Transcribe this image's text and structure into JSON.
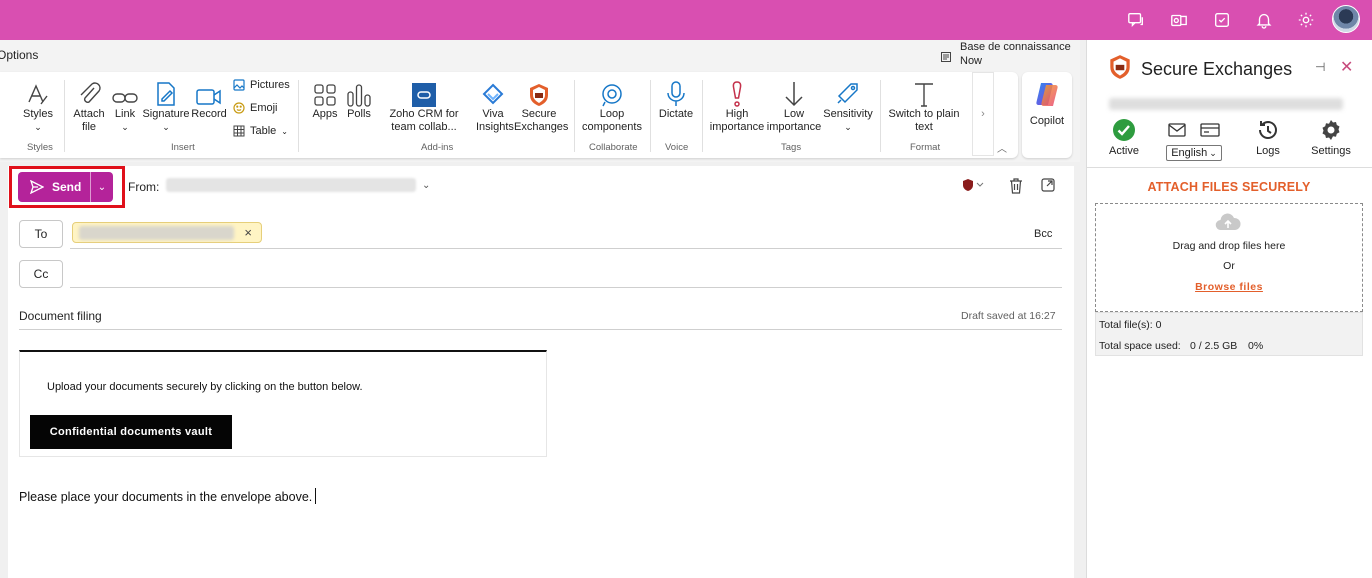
{
  "colors": {
    "topbar": "#d94fb1",
    "send": "#b4239a",
    "accent_orange": "#e35f2b",
    "highlight_box": "#e0101a"
  },
  "topbar": {
    "icons": [
      "chat-feedback-icon",
      "outlook-icon",
      "checklist-icon",
      "bell-icon",
      "settings-icon"
    ]
  },
  "header": {
    "options_label": "Options"
  },
  "knowledge_base": {
    "title": "Base de connaissance",
    "subtitle": "Now"
  },
  "ribbon": {
    "styles": {
      "label": "Styles",
      "group": "Styles"
    },
    "insert": {
      "attach": "Attach file",
      "link": "Link",
      "signature": "Signature",
      "record": "Record",
      "pictures": "Pictures",
      "emoji": "Emoji",
      "table": "Table",
      "group": "Insert"
    },
    "addins": {
      "apps": "Apps",
      "polls": "Polls",
      "zoho": "Zoho CRM for team collab...",
      "viva": "Viva Insights",
      "secure": "Secure Exchanges",
      "group": "Add-ins"
    },
    "collaborate": {
      "loop": "Loop components",
      "group": "Collaborate"
    },
    "voice": {
      "dictate": "Dictate",
      "group": "Voice"
    },
    "tags": {
      "high": "High importance",
      "low": "Low importance",
      "sensitivity": "Sensitivity",
      "group": "Tags"
    },
    "format": {
      "plain": "Switch to plain text",
      "group": "Format"
    },
    "copilot": "Copilot"
  },
  "compose": {
    "send_label": "Send",
    "from_label": "From:",
    "to_label": "To",
    "cc_label": "Cc",
    "bcc_label": "Bcc",
    "subject": "Document filing",
    "draft_status": "Draft saved at 16:27",
    "card_text": "Upload your documents securely by clicking on the button below.",
    "vault_button": "Confidential documents vault",
    "body_text": "Please place your documents in the envelope above."
  },
  "panel": {
    "title": "Secure Exchanges",
    "tools": {
      "active": "Active",
      "language": "English",
      "logs": "Logs",
      "settings": "Settings"
    },
    "attach_title": "ATTACH FILES SECURELY",
    "drop_text": "Drag and drop files here",
    "or_text": "Or",
    "browse": "Browse files",
    "total_files": "Total file(s): 0",
    "total_space_label": "Total space used:",
    "total_space_value": "0 / 2.5 GB",
    "total_space_percent": "0%"
  }
}
